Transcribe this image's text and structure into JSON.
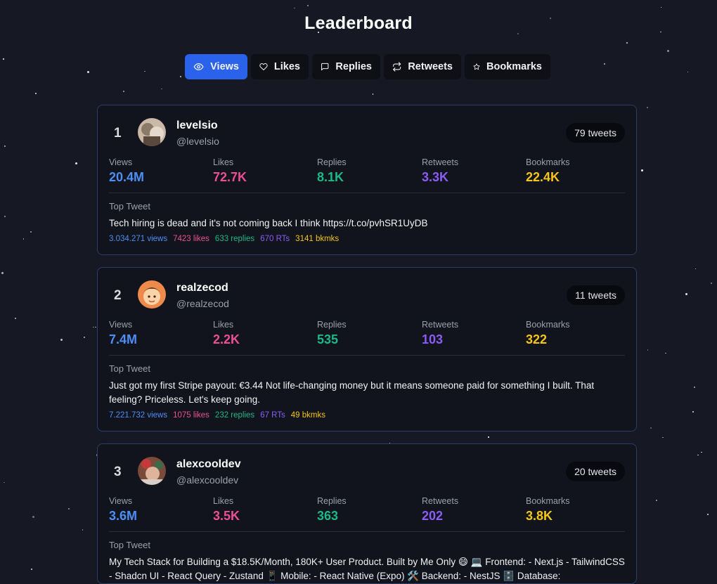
{
  "page": {
    "title": "Leaderboard"
  },
  "tabs": [
    {
      "label": "Views",
      "icon": "eye-icon",
      "active": true
    },
    {
      "label": "Likes",
      "icon": "heart-icon",
      "active": false
    },
    {
      "label": "Replies",
      "icon": "message-square-icon",
      "active": false
    },
    {
      "label": "Retweets",
      "icon": "repeat-icon",
      "active": false
    },
    {
      "label": "Bookmarks",
      "icon": "star-icon",
      "active": false
    }
  ],
  "stat_labels": {
    "views": "Views",
    "likes": "Likes",
    "replies": "Replies",
    "retweets": "Retweets",
    "bookmarks": "Bookmarks"
  },
  "top_tweet_label": "Top Tweet",
  "colors": {
    "accent": "#2a62ec",
    "views": "#4d8ef7",
    "likes": "#ec4f95",
    "replies": "#1db888",
    "retweets": "#8b5cf6",
    "bookmarks": "#f5c518"
  },
  "entries": [
    {
      "rank": "1",
      "name": "levelsio",
      "handle": "@levelsio",
      "tweet_count": "79 tweets",
      "views": "20.4M",
      "likes": "72.7K",
      "replies": "8.1K",
      "retweets": "3.3K",
      "bookmarks": "22.4K",
      "top_tweet": "Tech hiring is dead and it's not coming back I think https://t.co/pvhSR1UyDB",
      "tweet_views": "3.034.271 views",
      "tweet_likes": "7423 likes",
      "tweet_replies": "633 replies",
      "tweet_rts": "670 RTs",
      "tweet_bkmks": "3141 bkmks"
    },
    {
      "rank": "2",
      "name": "realzecod",
      "handle": "@realzecod",
      "tweet_count": "11 tweets",
      "views": "7.4M",
      "likes": "2.2K",
      "replies": "535",
      "retweets": "103",
      "bookmarks": "322",
      "top_tweet": "Just got my first Stripe payout: €3.44 Not life-changing money but it means someone paid for something I built. That feeling? Priceless. Let's keep going.",
      "tweet_views": "7.221.732 views",
      "tweet_likes": "1075 likes",
      "tweet_replies": "232 replies",
      "tweet_rts": "67 RTs",
      "tweet_bkmks": "49 bkmks"
    },
    {
      "rank": "3",
      "name": "alexcooldev",
      "handle": "@alexcooldev",
      "tweet_count": "20 tweets",
      "views": "3.6M",
      "likes": "3.5K",
      "replies": "363",
      "retweets": "202",
      "bookmarks": "3.8K",
      "top_tweet": "My Tech Stack for Building a $18.5K/Month, 180K+ User Product. Built by Me Only 😄 💻 Frontend: - Next.js - TailwindCSS - Shadcn UI - React Query - Zustand 📱 Mobile: - React Native (Expo) 🛠️ Backend: - NestJS 🗄️ Database:"
    }
  ]
}
